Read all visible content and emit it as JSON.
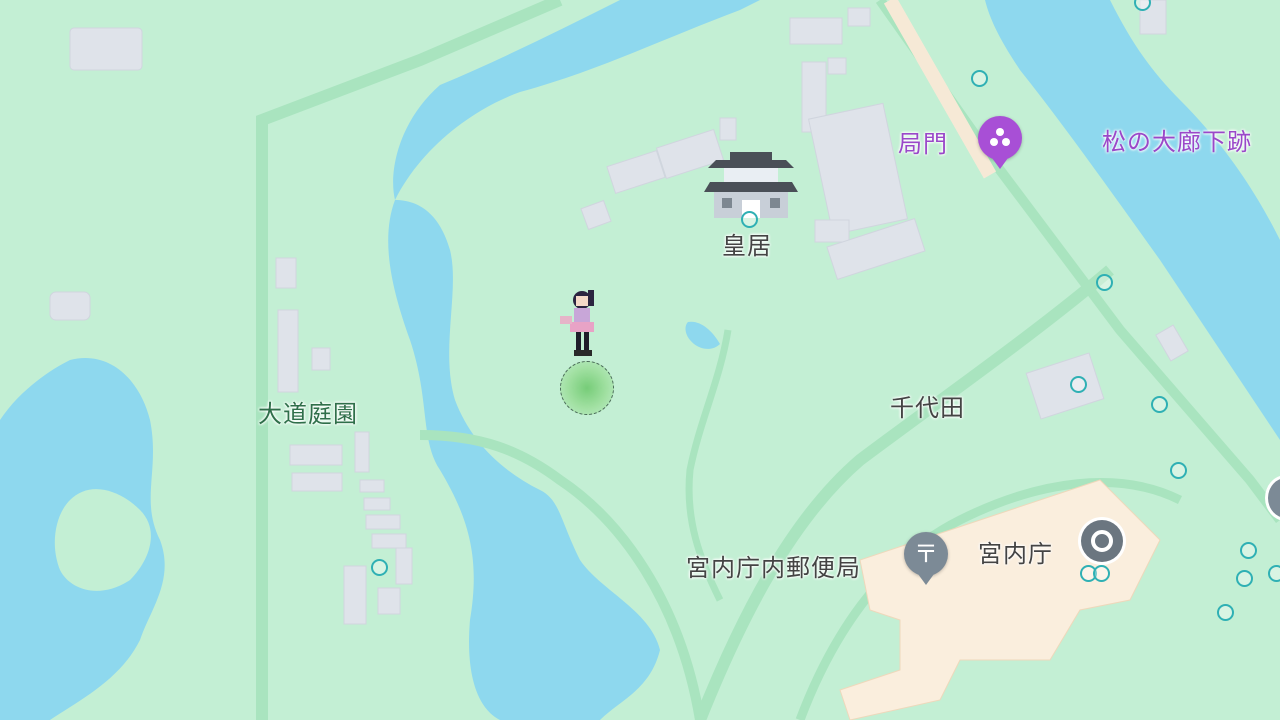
{
  "map": {
    "colors": {
      "land": "#c3efd4",
      "water": "#8ed8ee",
      "road": "#e7f7ec",
      "building": "#dfe3ea",
      "palace_building": "#faeedd",
      "poi_purple": "#a84fd6",
      "poi_gray": "#7c8a96",
      "poi_dot": "#2fb0b4"
    },
    "labels": {
      "kyokumon": "局門",
      "matsu_no_oroka": "松の大廊下跡",
      "kokyo": "皇居",
      "chiyoda": "千代田",
      "omichi_teien": "大道庭園",
      "post_office": "宮内庁内郵便局",
      "kunaicho": "宮内庁"
    },
    "icons": {
      "kyokumon_pin": "attraction-pin-icon",
      "post_office_pin": "post-office-icon",
      "kunaicho_marker": "government-office-icon",
      "palace": "castle-icon",
      "player": "avatar-icon"
    },
    "post_symbol": "〒"
  }
}
